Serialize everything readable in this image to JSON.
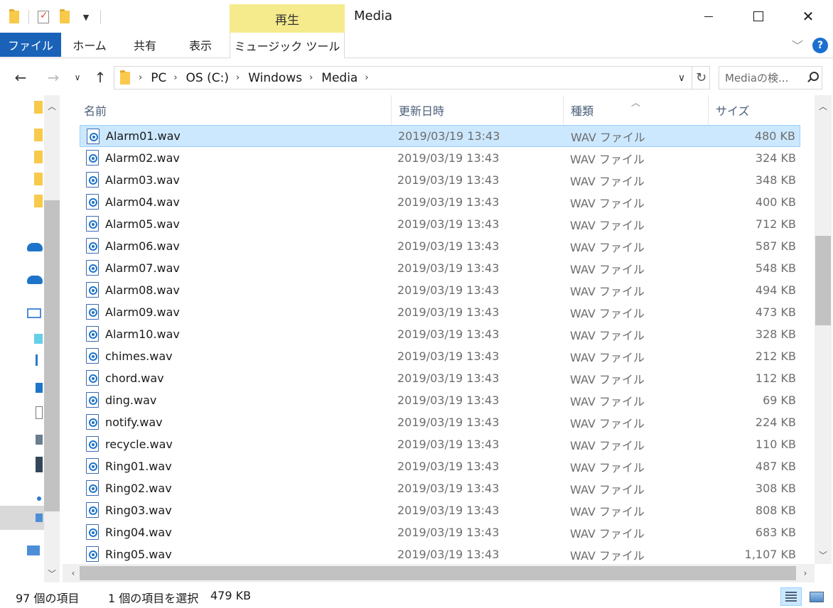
{
  "window": {
    "title": "Media",
    "contextual_tab_group": "再生"
  },
  "ribbon": {
    "tabs": [
      "ファイル",
      "ホーム",
      "共有",
      "表示",
      "ミュージック ツール"
    ],
    "accent": "#1962b8"
  },
  "address": {
    "crumbs": [
      "PC",
      "OS (C:)",
      "Windows",
      "Media"
    ]
  },
  "search": {
    "placeholder": "Mediaの検..."
  },
  "columns": {
    "name": "名前",
    "date": "更新日時",
    "type": "種類",
    "size": "サイズ"
  },
  "files": [
    {
      "name": "Alarm01.wav",
      "date": "2019/03/19 13:43",
      "type": "WAV ファイル",
      "size": "480 KB",
      "selected": true
    },
    {
      "name": "Alarm02.wav",
      "date": "2019/03/19 13:43",
      "type": "WAV ファイル",
      "size": "324 KB"
    },
    {
      "name": "Alarm03.wav",
      "date": "2019/03/19 13:43",
      "type": "WAV ファイル",
      "size": "348 KB"
    },
    {
      "name": "Alarm04.wav",
      "date": "2019/03/19 13:43",
      "type": "WAV ファイル",
      "size": "400 KB"
    },
    {
      "name": "Alarm05.wav",
      "date": "2019/03/19 13:43",
      "type": "WAV ファイル",
      "size": "712 KB"
    },
    {
      "name": "Alarm06.wav",
      "date": "2019/03/19 13:43",
      "type": "WAV ファイル",
      "size": "587 KB"
    },
    {
      "name": "Alarm07.wav",
      "date": "2019/03/19 13:43",
      "type": "WAV ファイル",
      "size": "548 KB"
    },
    {
      "name": "Alarm08.wav",
      "date": "2019/03/19 13:43",
      "type": "WAV ファイル",
      "size": "494 KB"
    },
    {
      "name": "Alarm09.wav",
      "date": "2019/03/19 13:43",
      "type": "WAV ファイル",
      "size": "473 KB"
    },
    {
      "name": "Alarm10.wav",
      "date": "2019/03/19 13:43",
      "type": "WAV ファイル",
      "size": "328 KB"
    },
    {
      "name": "chimes.wav",
      "date": "2019/03/19 13:43",
      "type": "WAV ファイル",
      "size": "212 KB"
    },
    {
      "name": "chord.wav",
      "date": "2019/03/19 13:43",
      "type": "WAV ファイル",
      "size": "112 KB"
    },
    {
      "name": "ding.wav",
      "date": "2019/03/19 13:43",
      "type": "WAV ファイル",
      "size": "69 KB"
    },
    {
      "name": "notify.wav",
      "date": "2019/03/19 13:43",
      "type": "WAV ファイル",
      "size": "224 KB"
    },
    {
      "name": "recycle.wav",
      "date": "2019/03/19 13:43",
      "type": "WAV ファイル",
      "size": "110 KB"
    },
    {
      "name": "Ring01.wav",
      "date": "2019/03/19 13:43",
      "type": "WAV ファイル",
      "size": "487 KB"
    },
    {
      "name": "Ring02.wav",
      "date": "2019/03/19 13:43",
      "type": "WAV ファイル",
      "size": "308 KB"
    },
    {
      "name": "Ring03.wav",
      "date": "2019/03/19 13:43",
      "type": "WAV ファイル",
      "size": "808 KB"
    },
    {
      "name": "Ring04.wav",
      "date": "2019/03/19 13:43",
      "type": "WAV ファイル",
      "size": "683 KB"
    },
    {
      "name": "Ring05.wav",
      "date": "2019/03/19 13:43",
      "type": "WAV ファイル",
      "size": "1,107 KB"
    }
  ],
  "status": {
    "item_count": "97 個の項目",
    "selection": "1 個の項目を選択",
    "selection_size": "479 KB"
  },
  "icons": {
    "file_type": "wav-file-icon",
    "nav_pane": [
      "folder-icon",
      "folder-icon",
      "folder-icon",
      "folder-icon",
      "folder-icon",
      "onedrive-icon",
      "onedrive-icon",
      "this-pc-icon",
      "3d-objects-icon",
      "downloads-icon",
      "desktop-icon",
      "documents-icon",
      "pictures-icon",
      "videos-icon",
      "music-icon",
      "windows-drive-icon",
      "network-icon"
    ]
  }
}
